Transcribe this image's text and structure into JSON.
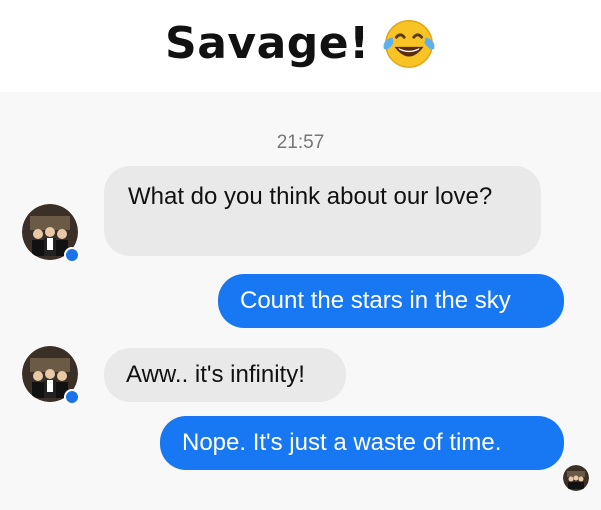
{
  "header": {
    "title": "Savage!",
    "emoji_icon": "face-with-tears-of-joy-icon"
  },
  "chat": {
    "timestamp": "21:57",
    "messages": [
      {
        "direction": "incoming",
        "text": "What do you think about our love?"
      },
      {
        "direction": "outgoing",
        "text": "Count the stars in the sky"
      },
      {
        "direction": "incoming",
        "text": "Aww.. it's infinity!"
      },
      {
        "direction": "outgoing",
        "text": "Nope. It's just a waste of time."
      }
    ]
  },
  "colors": {
    "outgoing_bubble": "#1877f2",
    "incoming_bubble": "#e9e9ea",
    "chat_background": "#f7f8f7",
    "messenger_badge": "#1a73e8"
  }
}
